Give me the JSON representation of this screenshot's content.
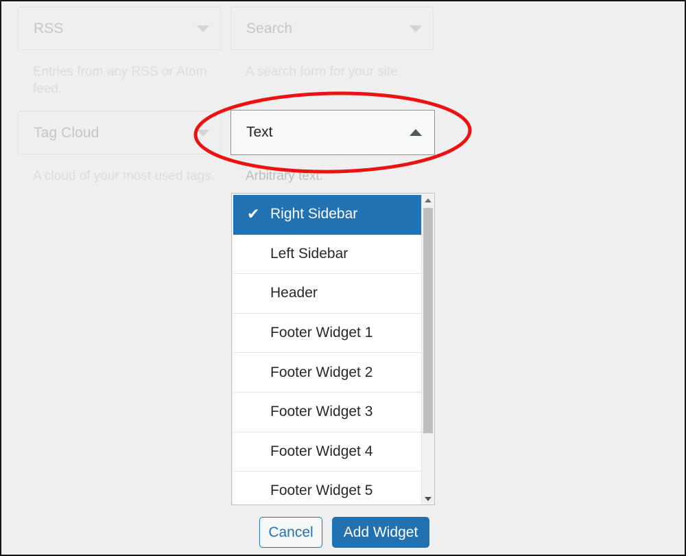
{
  "theme": {
    "accent": "#2271b1",
    "annotation_color": "#ee1111",
    "page_background": "#efefef",
    "selected_row_background": "#2271b1",
    "faded_text_color": "#c6c6c6"
  },
  "widget_grid": [
    {
      "name": "RSS",
      "description": "Entries from any RSS or Atom feed.",
      "caret_icon": "caret-down-icon",
      "state": "dimmed"
    },
    {
      "name": "Search",
      "description": "A search form for your site.",
      "caret_icon": "caret-down-icon",
      "state": "dimmed"
    },
    {
      "name": "Tag Cloud",
      "description": "A cloud of your most used tags.",
      "caret_icon": "caret-down-icon",
      "state": "dimmed"
    },
    {
      "name": "Text",
      "description": "Arbitrary text.",
      "caret_icon": "caret-up-icon",
      "state": "open"
    }
  ],
  "active_widget": {
    "label": "Text",
    "description": "Arbitrary text.",
    "caret_icon": "caret-up-icon",
    "expanded": true
  },
  "sidebar_select": {
    "selected_value": "Right Sidebar",
    "check_icon": "check-icon",
    "options": [
      {
        "label": "Right Sidebar",
        "selected": true
      },
      {
        "label": "Left Sidebar",
        "selected": false
      },
      {
        "label": "Header",
        "selected": false
      },
      {
        "label": "Footer Widget 1",
        "selected": false
      },
      {
        "label": "Footer Widget 2",
        "selected": false
      },
      {
        "label": "Footer Widget 3",
        "selected": false
      },
      {
        "label": "Footer Widget 4",
        "selected": false
      },
      {
        "label": "Footer Widget 5",
        "selected": false
      }
    ],
    "scrollbar": {
      "up_arrow_icon": "scroll-up-arrow-icon",
      "down_arrow_icon": "scroll-down-arrow-icon",
      "thumb_position_percent": 0,
      "visible_fraction_percent": 72
    }
  },
  "actions": {
    "cancel_label": "Cancel",
    "add_widget_label": "Add Widget"
  }
}
